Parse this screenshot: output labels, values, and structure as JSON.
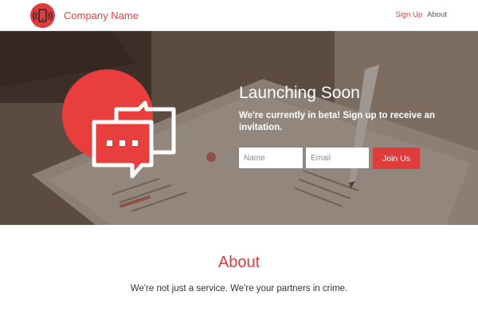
{
  "navbar": {
    "brand_name": "Company Name",
    "links": [
      {
        "label": "Sign Up",
        "active": true
      },
      {
        "label": "About",
        "active": false
      }
    ]
  },
  "hero": {
    "title": "Launching Soon",
    "subtitle": "We're currently in beta! Sign up to receive an invitation.",
    "form": {
      "name_placeholder": "Name",
      "email_placeholder": "Email",
      "submit_label": "Join Us"
    }
  },
  "about": {
    "title": "About",
    "text": "We're not just a service. We're your partners in crime."
  },
  "icons": {
    "brand_logo": "phone-signal-icon",
    "hero_graphic": "chat-bubbles-icon"
  },
  "colors": {
    "accent": "#e23b3b",
    "button": "#e03c3c",
    "hero_text": "#ffffff"
  }
}
